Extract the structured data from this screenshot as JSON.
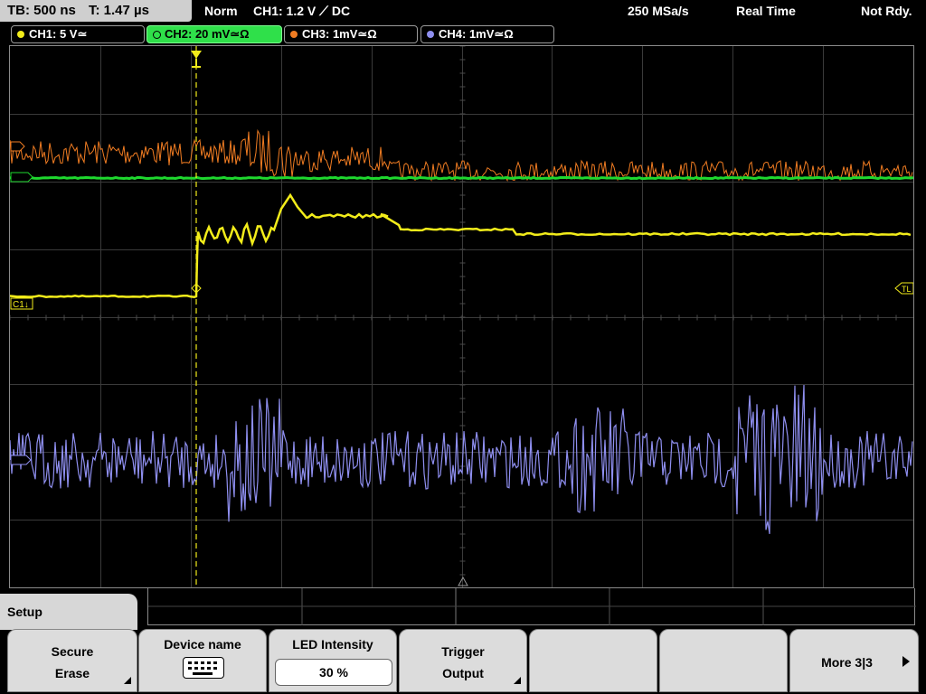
{
  "status": {
    "timebase": "TB: 500 ns",
    "trigger_time": "T: 1.47 µs",
    "mode": "Norm",
    "trigger_source": "CH1: 1.2 V ⟋ DC",
    "sample_rate": "250 MSa/s",
    "acq_mode": "Real Time",
    "ready_state": "Not Rdy."
  },
  "channels": [
    {
      "label": "CH1: 5 V≃",
      "color": "#f2ec1a"
    },
    {
      "label": "CH2: 20 mV≃Ω",
      "color": "#1ed82e"
    },
    {
      "label": "CH3: 1mV≃Ω",
      "color": "#f07c22"
    },
    {
      "label": "CH4: 1mV≃Ω",
      "color": "#8f8ff0"
    }
  ],
  "markers": {
    "c1": "C1↓",
    "tl": "TL"
  },
  "menu": {
    "title": "Setup",
    "softkeys": [
      {
        "line1": "Secure",
        "line2": "Erase"
      },
      {
        "line1": "Device name",
        "icon": "keyboard-icon"
      },
      {
        "line1": "LED Intensity",
        "value": "30 %"
      },
      {
        "line1": "Trigger",
        "line2": "Output"
      },
      {
        "line1": ""
      },
      {
        "line1": ""
      },
      {
        "line1": "More 3|3",
        "icon": "arrow-right-icon"
      }
    ]
  }
}
